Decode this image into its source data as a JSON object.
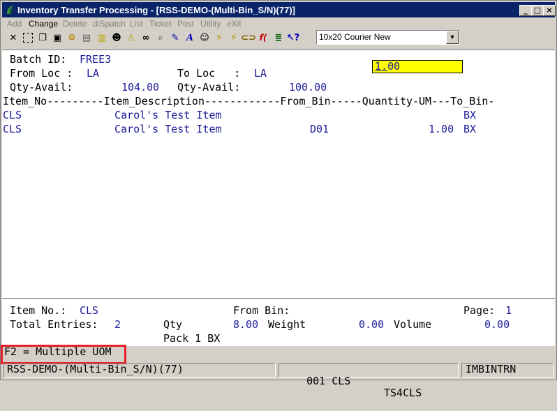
{
  "window": {
    "title": "Inventory Transfer Processing - [RSS-DEMO-(Multi-Bin_S/N)(77)]",
    "buttons": [
      "_",
      "□",
      "×"
    ]
  },
  "menu": [
    {
      "label": "Add",
      "enabled": false
    },
    {
      "label": "Change",
      "enabled": true
    },
    {
      "label": "Delete",
      "enabled": false
    },
    {
      "label": "diSpatch",
      "enabled": false
    },
    {
      "label": "List",
      "enabled": false
    },
    {
      "label": "Ticket",
      "enabled": false
    },
    {
      "label": "Post",
      "enabled": false
    },
    {
      "label": "Utility",
      "enabled": false
    },
    {
      "label": "eXit",
      "enabled": false
    }
  ],
  "toolbar": {
    "icons": [
      "close-x-icon",
      "select-icon",
      "copy-icon",
      "paste-icon",
      "gear-icon",
      "document-icon",
      "note-icon",
      "user-icon",
      "warning-icon",
      "binoculars-icon",
      "magnifier-icon",
      "tools-icon",
      "font-icon",
      "person-icon",
      "lightning-icon",
      "lightning-doc-icon",
      "link-icon",
      "function-icon",
      "list-icon",
      "help-pointer-icon"
    ],
    "font_select": "10x20 Courier New"
  },
  "form": {
    "batch_label": "Batch ID:",
    "batch_value": "FREE3",
    "from_loc_label": "From Loc :",
    "from_loc_value": "LA",
    "to_loc_label": "To Loc   :",
    "to_loc_value": "LA",
    "qty_avail_label1": "Qty-Avail:",
    "qty_avail_value1": "104.00",
    "qty_avail_label2": "Qty-Avail:",
    "qty_avail_value2": "100.00",
    "column_header": "Item_No---------Item_Description------------From_Bin-----Quantity-UM---To_Bin-",
    "rows": [
      {
        "item": "CLS",
        "desc": "Carol's Test Item",
        "from_bin": "",
        "qty": "1.00",
        "um": "BX"
      },
      {
        "item": "CLS",
        "desc": "Carol's Test Item",
        "from_bin": "D01",
        "qty": "1.00",
        "um": "BX"
      }
    ]
  },
  "footer": {
    "item_no_label": "Item No.:",
    "item_no_value": "CLS",
    "from_bin_label": "From Bin:",
    "page_label": "Page:",
    "page_value": "1",
    "total_label": "Total Entries:",
    "total_value": "2",
    "qty_label": "Qty",
    "qty_value": "8.00",
    "weight_label": "Weight",
    "weight_value": "0.00",
    "volume_label": "Volume",
    "volume_value": "0.00",
    "pack_text": "Pack 1 BX"
  },
  "hint": "F2 = Multiple UOM",
  "status": {
    "company": "RSS-DEMO-(Multi-Bin_S/N)(77)",
    "seg2": "001 CLS",
    "seg3": "TS4CLS",
    "seg4": "IMBINTRN"
  },
  "colors": {
    "title_bg": "#0a246a",
    "field_text": "#1c1c9a",
    "input_bg": "#ffff00",
    "hint_border": "#e8202a"
  }
}
